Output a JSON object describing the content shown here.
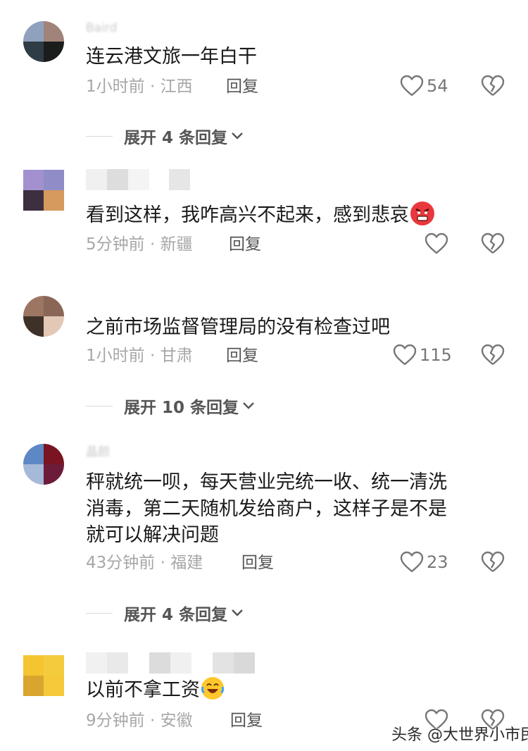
{
  "comments": [
    {
      "username": "Baird",
      "text": "连云港文旅一年白干",
      "meta": "1小时前 · 江西",
      "reply_label": "回复",
      "likes": "54",
      "expand_label": "展开 4 条回复"
    },
    {
      "username": "",
      "text": "看到这样，我咋高兴不起来，感到悲哀",
      "emoji": "angry-face-emoji",
      "meta": "5分钟前 · 新疆",
      "reply_label": "回复",
      "likes": ""
    },
    {
      "username": "",
      "text": "之前市场监督管理局的没有检查过吧",
      "meta": "1小时前 · 甘肃",
      "reply_label": "回复",
      "likes": "115",
      "expand_label": "展开 10 条回复"
    },
    {
      "username": "晶颜",
      "text_lines": [
        "秤就统一呗，每天营业完统一收、统一清洗",
        "消毒，第二天随机发给商户，这样子是不是",
        "就可以解决问题"
      ],
      "meta": "43分钟前 · 福建",
      "reply_label": "回复",
      "likes": "23",
      "expand_label": "展开 4 条回复"
    },
    {
      "username": "",
      "text": "以前不拿工资",
      "emoji": "laughing-crying-emoji",
      "meta": "9分钟前 · 安徽",
      "reply_label": "回复",
      "likes": ""
    }
  ],
  "watermark": "头条 @大世界小市民",
  "colors": {
    "text": "#1a1a1a",
    "meta": "#a7a7a7",
    "icon": "#777777"
  }
}
